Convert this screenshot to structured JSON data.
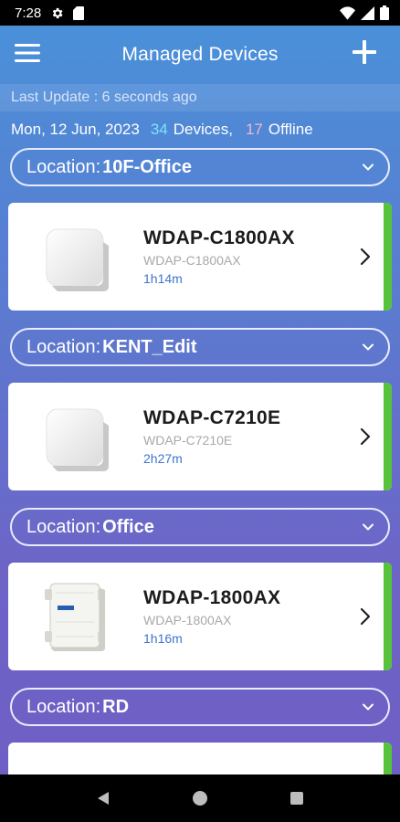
{
  "status_bar": {
    "time": "7:28"
  },
  "app_bar": {
    "title": "Managed Devices"
  },
  "last_update": "Last Update : 6 seconds ago",
  "summary": {
    "date": "Mon, 12 Jun, 2023",
    "device_count": "34",
    "devices_label": "Devices,",
    "offline_count": "17",
    "offline_label": "Offline"
  },
  "location_label": "Location:",
  "groups": [
    {
      "location": "10F-Office",
      "device": {
        "name": "WDAP-C1800AX",
        "model": "WDAP-C1800AX",
        "uptime": "1h14m",
        "status_color": "#56c33a"
      }
    },
    {
      "location": "KENT_Edit",
      "device": {
        "name": "WDAP-C7210E",
        "model": "WDAP-C7210E",
        "uptime": "2h27m",
        "status_color": "#56c33a"
      }
    },
    {
      "location": "Office",
      "device": {
        "name": "WDAP-1800AX",
        "model": "WDAP-1800AX",
        "uptime": "1h16m",
        "status_color": "#56c33a"
      }
    },
    {
      "location": "RD"
    }
  ],
  "colors": {
    "online": "#56c33a",
    "accent": "#3e74d1"
  }
}
